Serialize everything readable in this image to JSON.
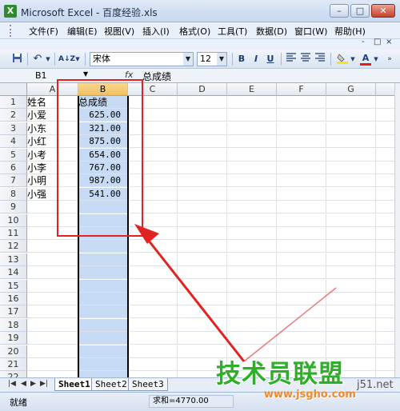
{
  "window": {
    "app_icon": "X",
    "title": "Microsoft Excel - 百度经验.xls",
    "min_label": "–",
    "max_label": "□",
    "close_label": "✕"
  },
  "menu": [
    "文件(F)",
    "编辑(E)",
    "视图(V)",
    "插入(I)",
    "格式(O)",
    "工具(T)",
    "数据(D)",
    "窗口(W)",
    "帮助(H)"
  ],
  "menu_right": [
    "-",
    "□",
    "×"
  ],
  "toolbar": {
    "font_name": "宋体",
    "font_size": "12",
    "bold": "B",
    "italic": "I",
    "underline": "U",
    "font_color_letter": "A"
  },
  "formula_bar": {
    "cell_ref": "B1",
    "fx": "fx",
    "content": "总成绩"
  },
  "columns": [
    "A",
    "B",
    "C",
    "D",
    "E",
    "F",
    "G"
  ],
  "selected_column": "B",
  "rows": [
    "1",
    "2",
    "3",
    "4",
    "5",
    "6",
    "7",
    "8",
    "9",
    "10",
    "11",
    "12",
    "13",
    "14",
    "15",
    "16",
    "17",
    "18",
    "19",
    "20",
    "21",
    "22"
  ],
  "cells": {
    "A": [
      "姓名",
      "小爱",
      "小东",
      "小红",
      "小考",
      "小李",
      "小明",
      "小强"
    ],
    "B": [
      "总成绩",
      "625.00",
      "321.00",
      "875.00",
      "654.00",
      "767.00",
      "987.00",
      "541.00"
    ]
  },
  "sheet_tabs": [
    "Sheet1",
    "Sheet2",
    "Sheet3"
  ],
  "active_sheet": "Sheet1",
  "status": {
    "ready": "就绪",
    "sum": "求和=4770.00"
  },
  "watermark": {
    "main": "技术员联盟",
    "url": "www.jsgho.com",
    "side": "j51.net"
  },
  "colors": {
    "annotation": "#e02222",
    "selection": "#c6daf3",
    "watermark_green": "#2fae2a"
  }
}
